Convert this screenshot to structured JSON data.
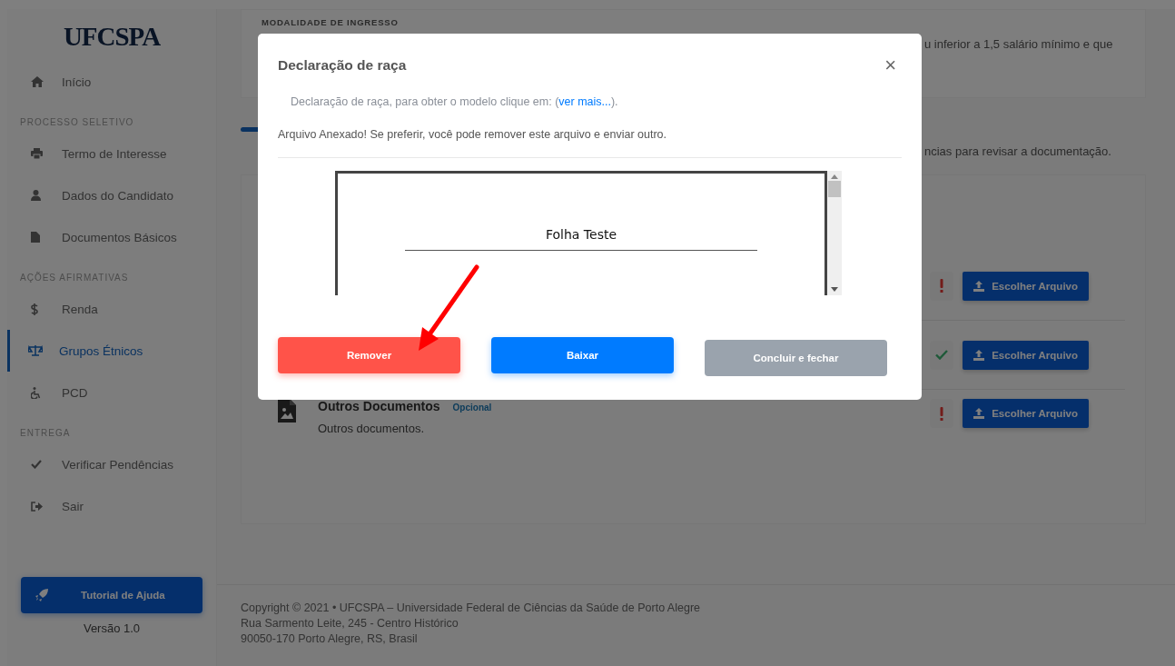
{
  "sidebar": {
    "logo": "UFCSPA",
    "groups": [
      {
        "items": [
          {
            "label": "Início",
            "selected": false
          }
        ]
      },
      {
        "title": "PROCESSO SELETIVO",
        "items": [
          {
            "label": "Termo de Interesse",
            "selected": false
          },
          {
            "label": "Dados do Candidato",
            "selected": false
          },
          {
            "label": "Documentos Básicos",
            "selected": false
          }
        ]
      },
      {
        "title": "AÇÕES AFIRMATIVAS",
        "items": [
          {
            "label": "Renda",
            "selected": false
          },
          {
            "label": "Grupos Étnicos",
            "selected": true
          },
          {
            "label": "PCD",
            "selected": false
          }
        ]
      },
      {
        "title": "ENTREGA",
        "items": [
          {
            "label": "Verificar Pendências",
            "selected": false
          },
          {
            "label": "Sair",
            "selected": false
          }
        ]
      }
    ],
    "help_button": "Tutorial de Ajuda",
    "version": "Versão 1.0"
  },
  "main": {
    "summary_card": {
      "label": "MODALIDADE DE INGRESSO",
      "text": "u inferior a 1,5 salário mínimo e que"
    },
    "instruction": "ncias para revisar a documentação.",
    "documents": [
      {
        "uploaded": false,
        "button": "Escolher Arquivo"
      },
      {
        "uploaded": true,
        "button": "Escolher Arquivo"
      },
      {
        "title": "Outros Documentos",
        "tag": "Opcional",
        "description": "Outros documentos.",
        "uploaded": false,
        "button": "Escolher Arquivo"
      }
    ]
  },
  "footer": {
    "lines": [
      "Copyright © 2021  •  UFCSPA – Universidade Federal de Ciências da Saúde de Porto Alegre",
      "Rua Sarmento Leite, 245 - Centro Histórico",
      "90050-170 Porto Alegre, RS, Brasil"
    ]
  },
  "modal": {
    "title": "Declaração de raça",
    "close": "×",
    "info": "Declaração de raça, para obter o modelo clique em: (",
    "link": "ver mais...",
    "info_end": ").",
    "message": "Arquivo Anexado! Se preferir, você pode remover este arquivo e enviar outro.",
    "preview": {
      "heading": "Folha Teste"
    },
    "buttons": [
      {
        "label": "Remover",
        "kind": "danger",
        "disabled": false
      },
      {
        "label": "Baixar",
        "kind": "primary",
        "disabled": false
      },
      {
        "label": "Concluir e fechar",
        "kind": "secondary",
        "disabled": true
      }
    ]
  }
}
